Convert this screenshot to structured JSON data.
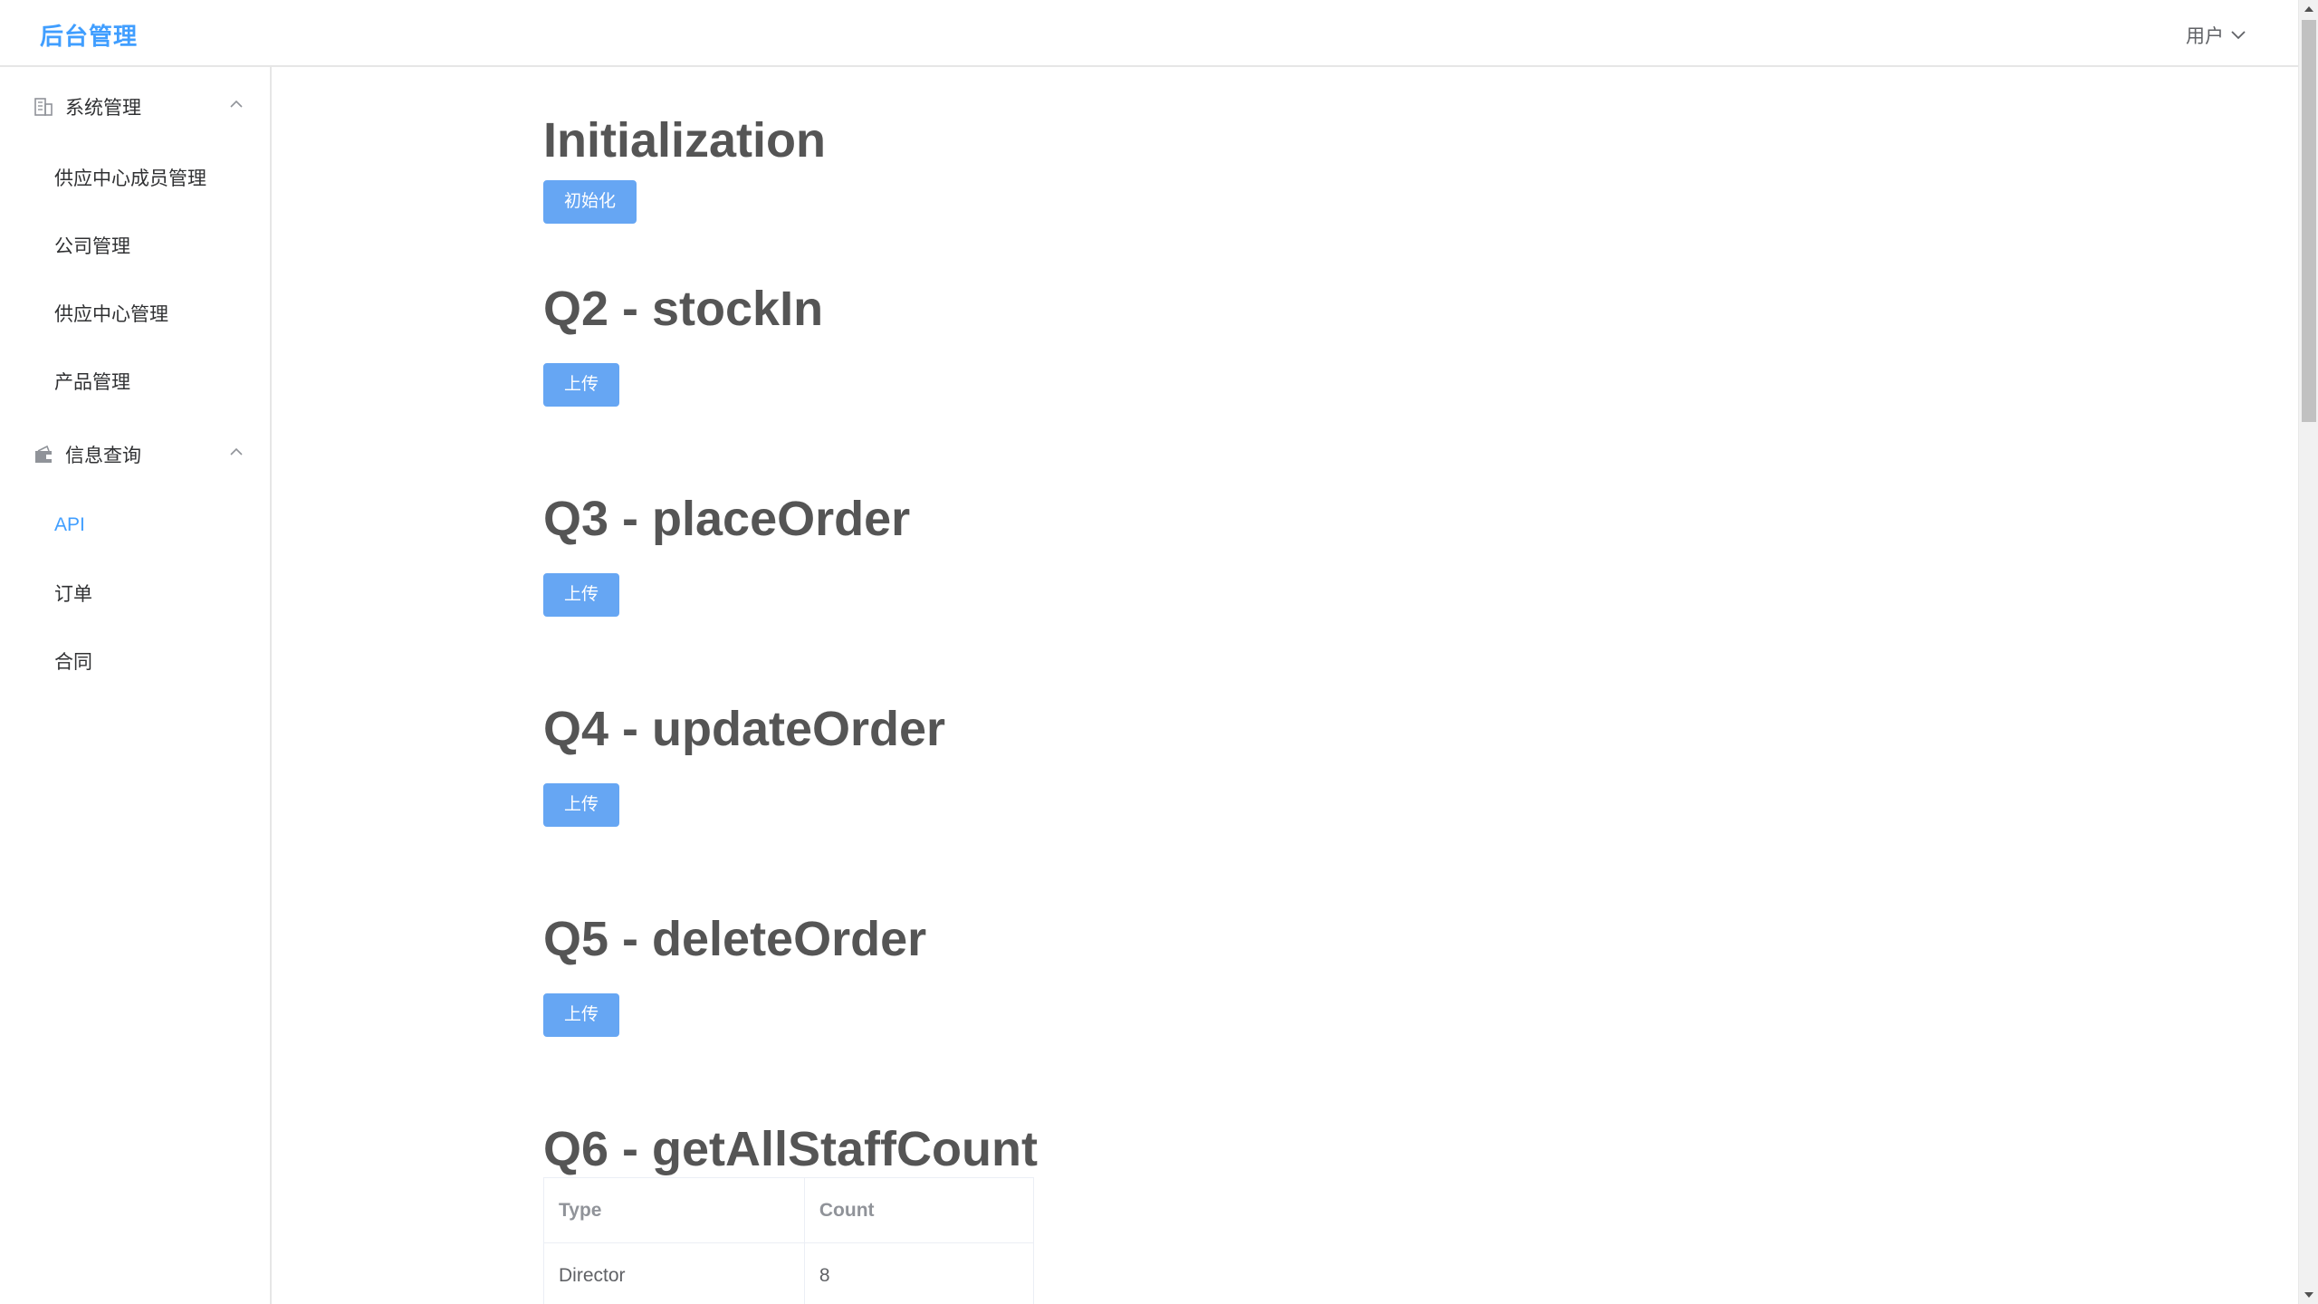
{
  "header": {
    "logo": "后台管理",
    "user_label": "用户"
  },
  "sidebar": {
    "groups": [
      {
        "title": "系统管理",
        "icon": "building-icon",
        "expanded": true,
        "items": [
          {
            "label": "供应中心成员管理",
            "active": false
          },
          {
            "label": "公司管理",
            "active": false
          },
          {
            "label": "供应中心管理",
            "active": false
          },
          {
            "label": "产品管理",
            "active": false
          }
        ]
      },
      {
        "title": "信息查询",
        "icon": "wallet-icon",
        "expanded": true,
        "items": [
          {
            "label": "API",
            "active": true
          },
          {
            "label": "订单",
            "active": false
          },
          {
            "label": "合同",
            "active": false
          }
        ]
      }
    ]
  },
  "main": {
    "sections": [
      {
        "title": "Initialization",
        "button": "初始化"
      },
      {
        "title": "Q2 - stockIn",
        "button": "上传"
      },
      {
        "title": "Q3 - placeOrder",
        "button": "上传"
      },
      {
        "title": "Q4 - updateOrder",
        "button": "上传"
      },
      {
        "title": "Q5 - deleteOrder",
        "button": "上传"
      },
      {
        "title": "Q6 - getAllStaffCount"
      }
    ],
    "table": {
      "headers": [
        "Type",
        "Count"
      ],
      "rows": [
        [
          "Director",
          "8"
        ]
      ]
    }
  },
  "colors": {
    "accent": "#409eff",
    "button_bg": "#66a6f3",
    "heading": "#555555"
  }
}
